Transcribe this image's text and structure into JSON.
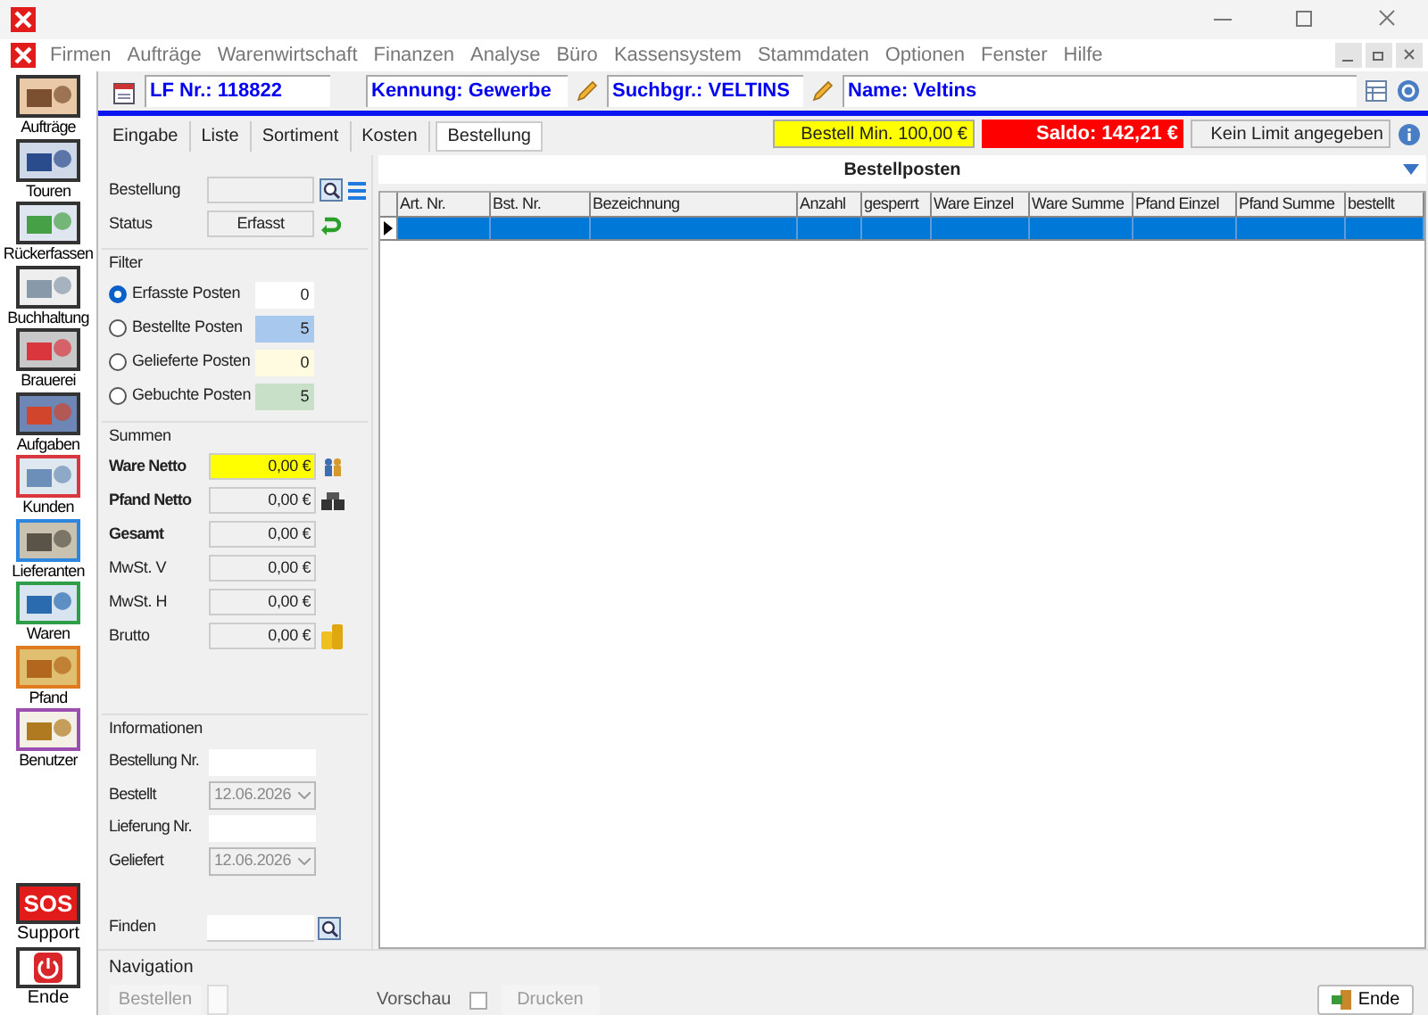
{
  "menu": [
    "Firmen",
    "Aufträge",
    "Warenwirtschaft",
    "Finanzen",
    "Analyse",
    "Büro",
    "Kassensystem",
    "Stammdaten",
    "Optionen",
    "Fenster",
    "Hilfe"
  ],
  "sidebar": {
    "items": [
      {
        "label": "Aufträge",
        "color": "#333333",
        "selected": false
      },
      {
        "label": "Touren",
        "color": "#333333",
        "selected": false
      },
      {
        "label": "Rückerfassen",
        "color": "#333333",
        "selected": false
      },
      {
        "label": "Buchhaltung",
        "color": "#333333",
        "selected": false
      },
      {
        "label": "Brauerei",
        "color": "#333333",
        "selected": false
      },
      {
        "label": "Aufgaben",
        "color": "#333333",
        "selected": false
      },
      {
        "label": "Kunden",
        "color": "#d9363e",
        "selected": false
      },
      {
        "label": "Lieferanten",
        "color": "#2e86de",
        "selected": false
      },
      {
        "label": "Waren",
        "color": "#2e9e48",
        "selected": false
      },
      {
        "label": "Pfand",
        "color": "#e07b20",
        "selected": false
      },
      {
        "label": "Benutzer",
        "color": "#9b4fb0",
        "selected": false
      }
    ],
    "bottom_items": [
      {
        "label": "Support",
        "icon_text": "SOS"
      },
      {
        "label": "Ende"
      }
    ]
  },
  "header": {
    "lf_nr": "LF Nr.: 118822",
    "kennung": "Kennung: Gewerbe",
    "suchbegriff": "Suchbgr.: VELTINS",
    "name": "Name: Veltins"
  },
  "tabs": [
    {
      "label": "Eingabe",
      "selected": false
    },
    {
      "label": "Liste",
      "selected": false
    },
    {
      "label": "Sortiment",
      "selected": false
    },
    {
      "label": "Kosten",
      "selected": false
    },
    {
      "label": "Bestellung",
      "selected": true
    }
  ],
  "info_bar": {
    "min_order": "Bestell Min. 100,00 €",
    "balance": "Saldo: 142,21 €",
    "limit": "Kein Limit angegeben"
  },
  "order": {
    "bestellung_label": "Bestellung",
    "status_label": "Status",
    "status": "Erfasst"
  },
  "filter": {
    "title": "Filter",
    "items": [
      {
        "label": "Erfasste Posten",
        "value": "0",
        "selected": true,
        "color": "#ffffff"
      },
      {
        "label": "Bestellte Posten",
        "value": "5",
        "selected": false,
        "color": "#a9c8ee"
      },
      {
        "label": "Gelieferte Posten",
        "value": "0",
        "selected": false,
        "color": "#fffbe0"
      },
      {
        "label": "Gebuchte Posten",
        "value": "5",
        "selected": false,
        "color": "#c8e0c8"
      }
    ]
  },
  "sums": {
    "title": "Summen",
    "rows": [
      {
        "label": "Ware Netto",
        "value": "0,00 €",
        "bold": true,
        "highlighted": true,
        "kind": "people"
      },
      {
        "label": "Pfand Netto",
        "value": "0,00 €",
        "bold": true,
        "highlighted": false,
        "kind": "crates"
      },
      {
        "label": "Gesamt",
        "value": "0,00 €",
        "bold": true,
        "highlighted": false,
        "kind": "plain"
      },
      {
        "label": "MwSt. V",
        "value": "0,00 €",
        "bold": false,
        "highlighted": false,
        "kind": "plain"
      },
      {
        "label": "MwSt. H",
        "value": "0,00 €",
        "bold": false,
        "highlighted": false,
        "kind": "plain"
      },
      {
        "label": "Brutto",
        "value": "0,00 €",
        "bold": false,
        "highlighted": false,
        "kind": "coins"
      }
    ]
  },
  "information": {
    "title": "Informationen",
    "fields": [
      {
        "label": "Bestellung Nr.",
        "kind": "text"
      },
      {
        "label": "Bestellt",
        "kind": "date",
        "value": "12.06.2026"
      },
      {
        "label": "Lieferung Nr.",
        "kind": "text"
      },
      {
        "label": "Geliefert",
        "kind": "date",
        "value": "12.06.2026"
      }
    ],
    "find_label": "Finden"
  },
  "grid": {
    "title": "Bestellposten",
    "columns": [
      "Art. Nr.",
      "Bst. Nr.",
      "Bezeichnung",
      "Anzahl",
      "gesperrt",
      "Ware Einzel",
      "Ware Summe",
      "Pfand Einzel",
      "Pfand Summe",
      "bestellt"
    ],
    "rows": [
      {
        "selected": true
      }
    ]
  },
  "navigation": {
    "title": "Navigation",
    "order_button": {
      "label": "Bestellen",
      "disabled": true
    },
    "preview": {
      "label": "Vorschau",
      "checked": false
    },
    "print_button": {
      "label": "Drucken",
      "disabled": true
    },
    "end_button": {
      "label": "Ende"
    }
  }
}
